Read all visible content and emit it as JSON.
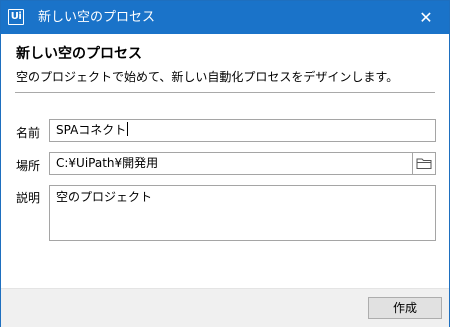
{
  "window": {
    "logo_text": "Ui",
    "title": "新しい空のプロセス",
    "close_glyph": "✕"
  },
  "header": {
    "title": "新しい空のプロセス",
    "description": "空のプロジェクトで始めて、新しい自動化プロセスをデザインします。"
  },
  "form": {
    "name_label": "名前",
    "name_value": "SPAコネクト",
    "location_label": "場所",
    "location_value": "C:¥UiPath¥開発用",
    "description_label": "説明",
    "description_value": "空のプロジェクト"
  },
  "icons": {
    "browse": "folder-icon",
    "close": "close-icon"
  },
  "footer": {
    "create_label": "作成"
  },
  "colors": {
    "titlebar": "#1a73c9",
    "footer": "#f0f0f0",
    "button": "#e1e1e1"
  }
}
